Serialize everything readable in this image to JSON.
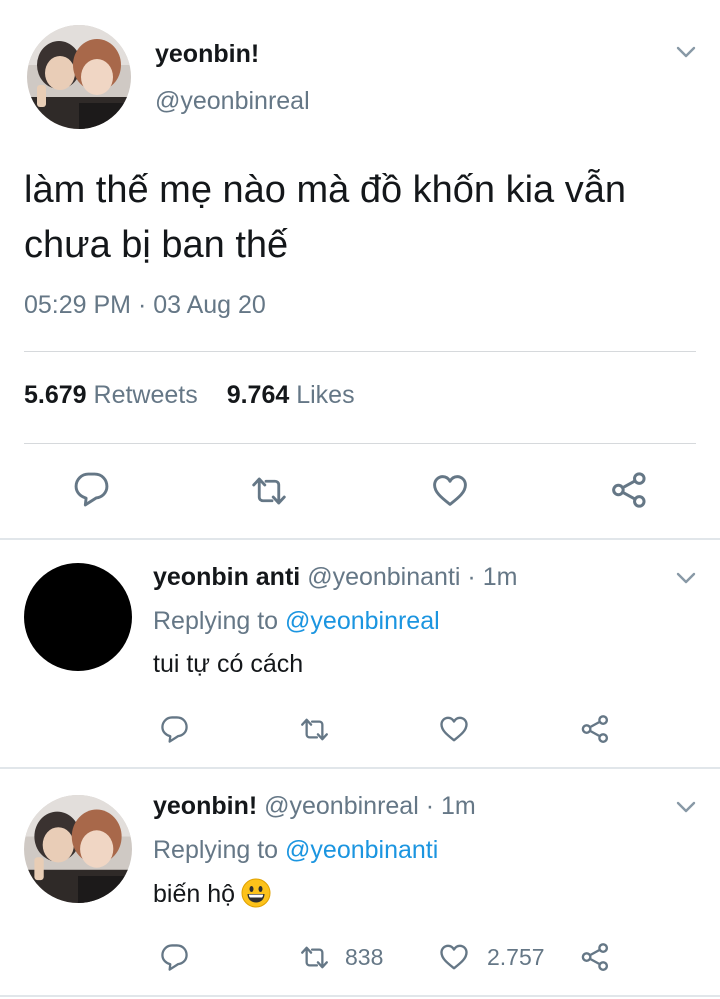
{
  "main_tweet": {
    "display_name": "yeonbin!",
    "handle": "@yeonbinreal",
    "text": "làm thế mẹ nào mà đồ khốn kia vẫn chưa bị ban thế",
    "timestamp": "05:29 PM · 03 Aug 20",
    "retweets_count": "5.679",
    "retweets_label": "Retweets",
    "likes_count": "9.764",
    "likes_label": "Likes"
  },
  "replies": [
    {
      "display_name": "yeonbin anti",
      "handle": "@yeonbinanti",
      "separator": "·",
      "time": "1m",
      "replying_prefix": "Replying to",
      "replying_to": "@yeonbinreal",
      "text": "tui tự có cách",
      "retweet_count": "",
      "like_count": ""
    },
    {
      "display_name": "yeonbin!",
      "handle": "@yeonbinreal",
      "separator": "·",
      "time": "1m",
      "replying_prefix": "Replying to",
      "replying_to": "@yeonbinanti",
      "text": "biến hộ",
      "emoji": "grinning-face",
      "retweet_count": "838",
      "like_count": "2.757"
    }
  ],
  "colors": {
    "text": "#14171a",
    "muted": "#657786",
    "link": "#1b95e0",
    "divider": "#e1e6ea"
  },
  "icons": [
    "reply-icon",
    "retweet-icon",
    "like-icon",
    "share-icon",
    "chevron-down-icon"
  ]
}
